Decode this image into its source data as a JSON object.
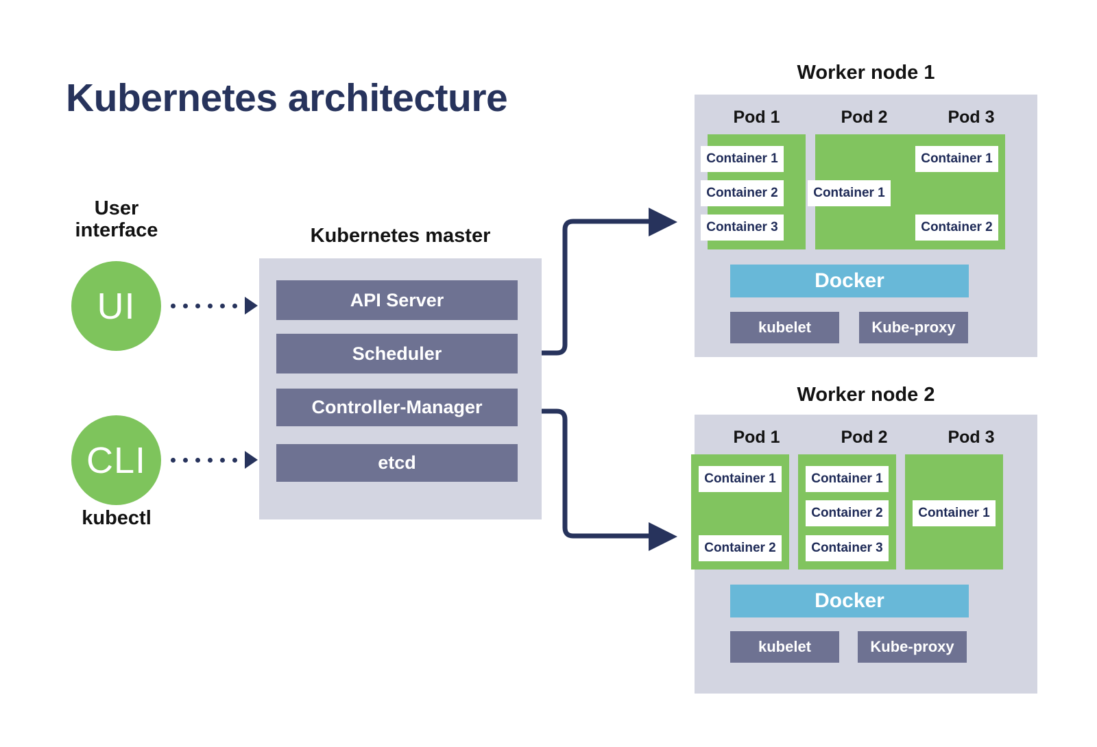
{
  "title": "Kubernetes architecture",
  "colors": {
    "title_navy": "#27335c",
    "panel_gray": "#d3d5e1",
    "slate": "#6e7292",
    "green": "#81c45f",
    "circle_green": "#7ec45c",
    "docker_blue": "#68b8d8",
    "container_text": "#1e2a57",
    "arrow_navy": "#27335c",
    "white": "#ffffff",
    "black": "#121212"
  },
  "user_interface": {
    "caption": "User\ninterface",
    "ui_circle_label": "UI",
    "cli_circle_label": "CLI",
    "kubectl_label": "kubectl",
    "ui_arrow_icon": "dotted-arrow-right-icon",
    "cli_arrow_icon": "dotted-arrow-right-icon"
  },
  "master": {
    "caption": "Kubernetes master",
    "components": [
      {
        "label": "API Server"
      },
      {
        "label": "Scheduler"
      },
      {
        "label": "Controller-Manager"
      },
      {
        "label": "etcd"
      }
    ]
  },
  "connectors": [
    {
      "name": "master-to-worker-1",
      "icon": "elbow-arrow-up-right-icon"
    },
    {
      "name": "master-to-worker-2",
      "icon": "elbow-arrow-down-right-icon"
    }
  ],
  "workers": [
    {
      "title": "Worker node 1",
      "docker_label": "Docker",
      "kubelet_label": "kubelet",
      "kube_proxy_label": "Kube-proxy",
      "pods": [
        {
          "label": "Pod 1",
          "containers": [
            {
              "label": "Container 1"
            },
            {
              "label": "Container 2"
            },
            {
              "label": "Container 3"
            }
          ]
        },
        {
          "label": "Pod 2",
          "containers": [
            {
              "label": "Container 1"
            }
          ]
        },
        {
          "label": "Pod 3",
          "containers": [
            {
              "label": "Container 1"
            },
            {
              "label": "Container 2"
            }
          ]
        }
      ]
    },
    {
      "title": "Worker node 2",
      "docker_label": "Docker",
      "kubelet_label": "kubelet",
      "kube_proxy_label": "Kube-proxy",
      "pods": [
        {
          "label": "Pod 1",
          "containers": [
            {
              "label": "Container 1"
            },
            {
              "label": "Container 2"
            }
          ]
        },
        {
          "label": "Pod 2",
          "containers": [
            {
              "label": "Container 1"
            },
            {
              "label": "Container 2"
            },
            {
              "label": "Container 3"
            }
          ]
        },
        {
          "label": "Pod 3",
          "containers": [
            {
              "label": "Container 1"
            }
          ]
        }
      ]
    }
  ]
}
